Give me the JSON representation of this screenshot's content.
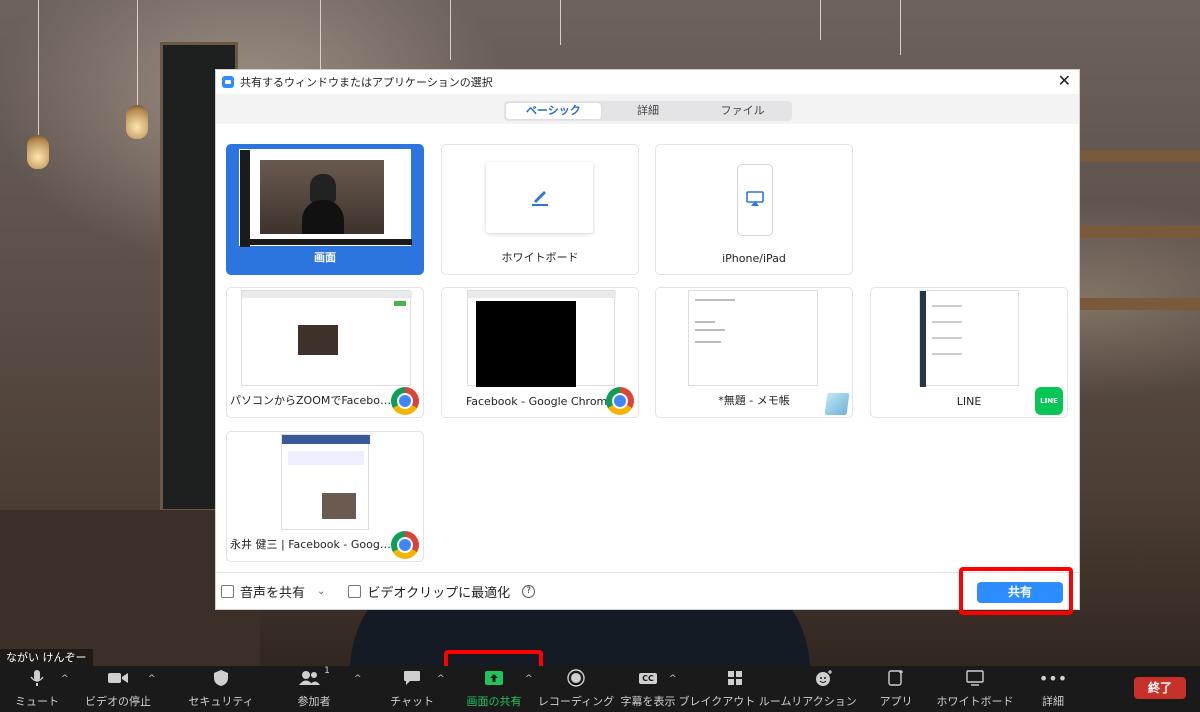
{
  "participant_name": "ながい けんぞー",
  "dialog": {
    "title": "共有するウィンドウまたはアプリケーションの選択",
    "tabs": [
      {
        "label": "ベーシック",
        "active": true
      },
      {
        "label": "詳細",
        "active": false
      },
      {
        "label": "ファイル",
        "active": false
      }
    ],
    "cards": [
      {
        "label": "画面",
        "selected": true
      },
      {
        "label": "ホワイトボード",
        "icon": "pen-icon"
      },
      {
        "label": "iPhone/iPad",
        "icon": "airplay-icon"
      },
      {
        "label": "パソコンからZOOMでFacebookLIV...",
        "badge": "chrome-icon"
      },
      {
        "label": "Facebook - Google Chrome",
        "badge": "chrome-icon"
      },
      {
        "label": "*無題 - メモ帳",
        "badge": "notepad-icon"
      },
      {
        "label": "LINE",
        "badge": "line-icon",
        "badge_text": "LINE"
      },
      {
        "label": "永井 健三 | Facebook - Google C...",
        "badge": "chrome-icon"
      }
    ],
    "share_audio_label": "音声を共有",
    "optimize_video_label": "ビデオクリップに最適化",
    "help_symbol": "?",
    "share_button_label": "共有"
  },
  "toolbar": {
    "mute": "ミュート",
    "stop_video": "ビデオの停止",
    "security": "セキュリティ",
    "participants": "参加者",
    "participants_count": "1",
    "chat": "チャット",
    "share_screen": "画面の共有",
    "recording": "レコーディング",
    "captions": "字幕を表示",
    "captions_icon_text": "CC",
    "breakout": "ブレイクアウト ルーム",
    "reactions": "リアクション",
    "apps": "アプリ",
    "whiteboard": "ホワイトボード",
    "more": "詳細",
    "end": "終了"
  },
  "colors": {
    "accent": "#2d8cff",
    "selected_card": "#2d75de",
    "highlight": "#ff0000",
    "share_green": "#21c45c",
    "end_red": "#c8312a"
  }
}
